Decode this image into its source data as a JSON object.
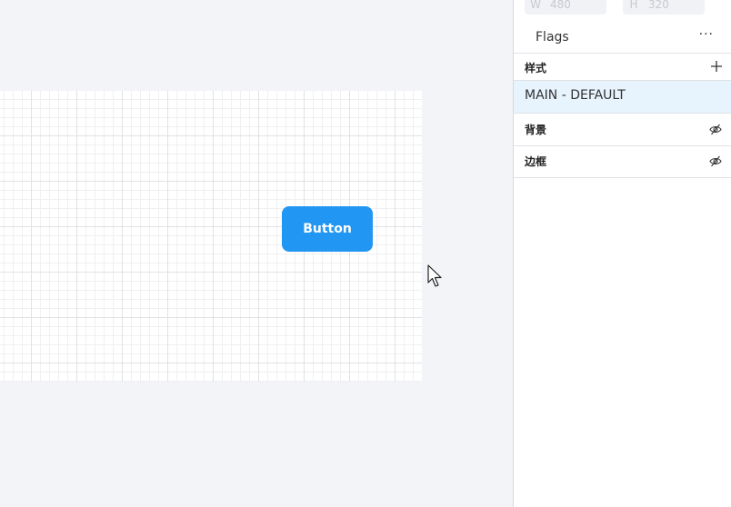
{
  "canvas": {
    "button_label": "Button",
    "button_color": "#2196f3"
  },
  "panel": {
    "width_field": {
      "label": "W",
      "value": "480"
    },
    "height_field": {
      "label": "H",
      "value": "320"
    },
    "flags_label": "Flags",
    "more_icon": "···",
    "styles_section": {
      "title": "样式",
      "add_icon": "plus-icon"
    },
    "selected_style": "MAIN - DEFAULT",
    "background_section": {
      "title": "背景",
      "visibility_icon": "eye-off-icon"
    },
    "border_section": {
      "title": "边框",
      "visibility_icon": "eye-off-icon"
    },
    "selection_color": "#e7f3fd"
  }
}
